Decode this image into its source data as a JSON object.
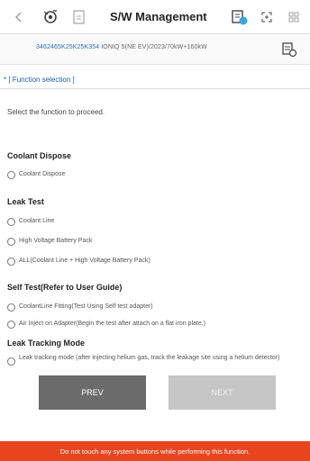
{
  "header": {
    "title": "S/W Management",
    "icons": [
      "back-arrow-icon",
      "vehicle-connect-icon",
      "document-icon",
      "vci-status-icon",
      "expand-icon",
      "grid-menu-icon"
    ]
  },
  "vehicle": {
    "vin": "3462465K25K25K354",
    "info": " IONIQ 5(NE EV)/2023/70kW+160kW"
  },
  "section": {
    "star": "*",
    "title": "[ Function selection ]"
  },
  "instruction": "Select the function to proceed.",
  "groups": {
    "coolant_dispose": {
      "title": "Coolant Dispose",
      "options": [
        "Coolant Dispose"
      ]
    },
    "leak_test": {
      "title": "Leak Test",
      "options": [
        "Coolant Line",
        "High Voltage Battery Pack",
        "ALL(Coolant Line + High Voltage Battery Pack)"
      ]
    },
    "self_test": {
      "title": "Self Test(Refer to User Guide)",
      "options": [
        "CoolantLine Fitting(Test Using Self test adapter)",
        "Air Inject on Adapter(Begin the test after attach on a flat iron plate.)"
      ]
    },
    "leak_tracking": {
      "title": "Leak Tracking Mode",
      "options": [
        "Leak tracking mode (after injecting helium gas, track the leakage site using a helium detector)"
      ]
    }
  },
  "buttons": {
    "prev": "PREV",
    "next": "NEXT"
  },
  "warning": "Do not touch any system buttons while performing this function.",
  "colors": {
    "accent": "#1a5fa8",
    "warning_bar": "#e8451f",
    "prev_button": "#6b6b6b",
    "next_button_disabled": "#c6c6c6"
  }
}
